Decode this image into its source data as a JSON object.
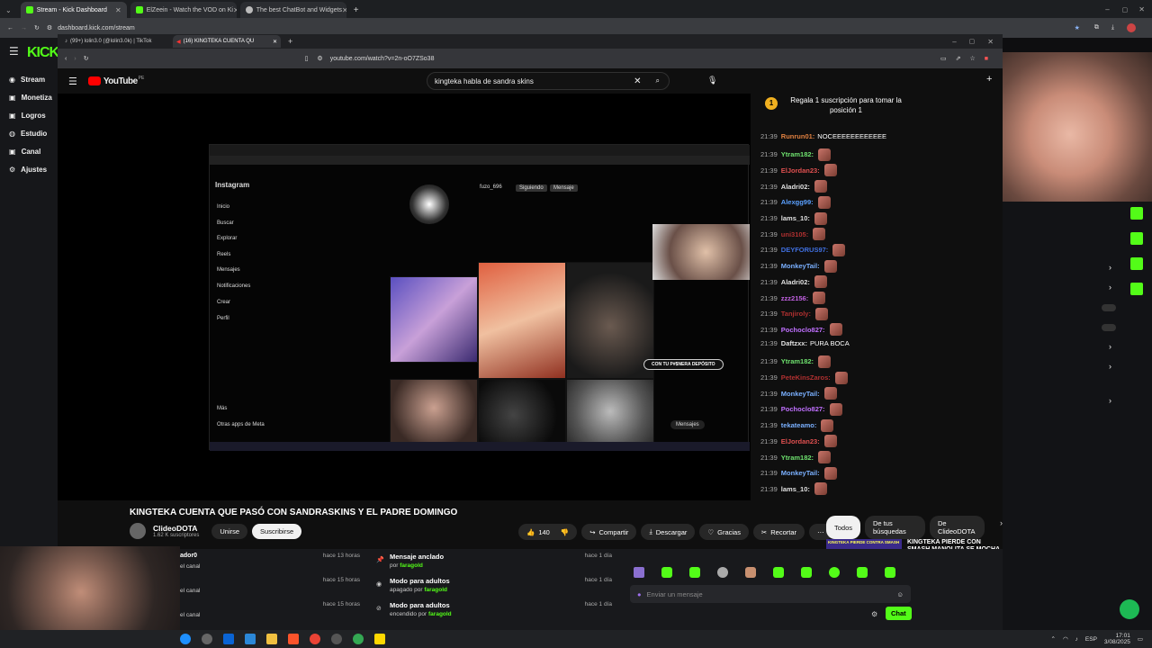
{
  "outer_tabs": [
    {
      "label": "Stream - Kick Dashboard",
      "color": "#53fc18"
    },
    {
      "label": "ElZeein - Watch the VOD on Ki",
      "color": "#53fc18"
    },
    {
      "label": "The best ChatBot and Widgets",
      "color": "#ffffff"
    }
  ],
  "outer_url": "dashboard.kick.com/stream",
  "kick": {
    "logo": "KICK",
    "nav": [
      {
        "label": "Stream",
        "icon": "broadcast-icon"
      },
      {
        "label": "Monetiza",
        "icon": "money-icon"
      },
      {
        "label": "Logros",
        "icon": "trophy-icon"
      },
      {
        "label": "Estudio",
        "icon": "studio-icon"
      },
      {
        "label": "Canal",
        "icon": "channel-icon"
      },
      {
        "label": "Ajustes",
        "icon": "gear-icon"
      }
    ]
  },
  "inner_tabs": [
    {
      "label": "(99+) lolin3.0 (@lolin3.0k) | TikTok"
    },
    {
      "label": "(16) KINGTEKA CUENTA QU"
    }
  ],
  "inner_url": "youtube.com/watch?v=2n-oO7ZSo38",
  "youtube": {
    "logo": "YouTube",
    "region": "PE",
    "search_value": "kingteka habla de sandra skins",
    "video_title": "KINGTEKA CUENTA QUE PASÓ CON SANDRASKINS Y EL PADRE DOMINGO",
    "channel": "ClideoDOTA",
    "subscribers": "1.62 K suscriptores",
    "join": "Unirse",
    "subscribe": "Suscribirse",
    "likes": "140",
    "share": "Compartir",
    "download": "Descargar",
    "thanks": "Gracias",
    "clip": "Recortar",
    "chips": [
      "Todos",
      "De tus búsquedas",
      "De ClideoDOTA"
    ],
    "rec_title": "KINGTEKA PIERDE CON SMASH MANOLITA SE MOCHA CON",
    "rec_thumb_text": "KINGTEKA PIERDE CONTRA SMASH"
  },
  "live_chat": {
    "pinned_count": "1",
    "pinned_text": "Regala 1 suscripción para tomar la posición 1",
    "messages": [
      {
        "time": "21:39",
        "user": "Runrun01:",
        "text": "NOCEEEEEEEEEEEE",
        "color": "#e08040",
        "emote": false
      },
      {
        "time": "21:39",
        "user": "Ytram182:",
        "text": "",
        "color": "#6ee06e",
        "emote": true
      },
      {
        "time": "21:39",
        "user": "ElJordan23:",
        "text": "",
        "color": "#e05050",
        "emote": true
      },
      {
        "time": "21:39",
        "user": "Aladri02:",
        "text": "",
        "color": "#e0e0e0",
        "emote": true
      },
      {
        "time": "21:39",
        "user": "Alexgg99:",
        "text": "",
        "color": "#5aa0ff",
        "emote": true
      },
      {
        "time": "21:39",
        "user": "lams_10:",
        "text": "",
        "color": "#e0e0e0",
        "emote": true
      },
      {
        "time": "21:39",
        "user": "uni3105:",
        "text": "",
        "color": "#b03030",
        "emote": true
      },
      {
        "time": "21:39",
        "user": "DEYFORUS97:",
        "text": "",
        "color": "#4070e0",
        "emote": true
      },
      {
        "time": "21:39",
        "user": "MonkeyTail:",
        "text": "",
        "color": "#7ab0ff",
        "emote": true
      },
      {
        "time": "21:39",
        "user": "Aladri02:",
        "text": "",
        "color": "#e0e0e0",
        "emote": true
      },
      {
        "time": "21:39",
        "user": "zzz2156:",
        "text": "",
        "color": "#c060e0",
        "emote": true
      },
      {
        "time": "21:39",
        "user": "Tanjiroly:",
        "text": "",
        "color": "#b03030",
        "emote": true
      },
      {
        "time": "21:39",
        "user": "Pochoclo827:",
        "text": "",
        "color": "#c070ff",
        "emote": true
      },
      {
        "time": "21:39",
        "user": "Daftzxx:",
        "text": "PURA BOCA",
        "color": "#e0e0e0",
        "emote": false
      },
      {
        "time": "21:39",
        "user": "Ytram182:",
        "text": "",
        "color": "#6ee06e",
        "emote": true
      },
      {
        "time": "21:39",
        "user": "PeteKinsZaros:",
        "text": "",
        "color": "#b03030",
        "emote": true
      },
      {
        "time": "21:39",
        "user": "MonkeyTail:",
        "text": "",
        "color": "#7ab0ff",
        "emote": true
      },
      {
        "time": "21:39",
        "user": "Pochoclo827:",
        "text": "",
        "color": "#c070ff",
        "emote": true
      },
      {
        "time": "21:39",
        "user": "tekateamo:",
        "text": "",
        "color": "#7ab0ff",
        "emote": true
      },
      {
        "time": "21:39",
        "user": "ElJordan23:",
        "text": "",
        "color": "#e05050",
        "emote": true
      },
      {
        "time": "21:39",
        "user": "Ytram182:",
        "text": "",
        "color": "#6ee06e",
        "emote": true
      },
      {
        "time": "21:39",
        "user": "MonkeyTail:",
        "text": "",
        "color": "#7ab0ff",
        "emote": true
      },
      {
        "time": "21:39",
        "user": "lams_10:",
        "text": "",
        "color": "#e0e0e0",
        "emote": true
      }
    ]
  },
  "instagram": {
    "logo": "Instagram",
    "nav": [
      "Inicio",
      "Buscar",
      "Explorar",
      "Reels",
      "Mensajes",
      "Notificaciones",
      "Crear",
      "Perfil",
      "Más",
      "Otras apps de Meta"
    ],
    "username": "fuzo_696",
    "following": "Siguiendo",
    "message": "Mensaje",
    "banner": "CON TU P#$NERA DEPÓSITO",
    "msgs_label": "Mensajes"
  },
  "activity": [
    {
      "user": "ador0",
      "sub": "el canal",
      "time": "hace 13 horas"
    },
    {
      "user": "",
      "sub": "el canal",
      "time": "hace 15 horas"
    },
    {
      "user": "",
      "sub": "el canal",
      "time": "hace 15 horas"
    }
  ],
  "mod_log": [
    {
      "title": "Mensaje anclado",
      "sub": "por",
      "by": "faragold",
      "time": "hace 1 día",
      "icon": "pin-icon"
    },
    {
      "title": "Modo para adultos",
      "sub": "apagado por",
      "by": "faragold",
      "time": "hace 1 día",
      "icon": "eye-icon"
    },
    {
      "title": "Modo para adultos",
      "sub": "encendido por",
      "by": "faragold",
      "time": "hace 1 día",
      "icon": "eye-off-icon"
    }
  ],
  "kick_chat": {
    "placeholder": "Enviar un mensaje",
    "send": "Chat"
  },
  "taskbar": {
    "lang": "ESP",
    "time": "17:01",
    "date": "3/08/2025"
  }
}
